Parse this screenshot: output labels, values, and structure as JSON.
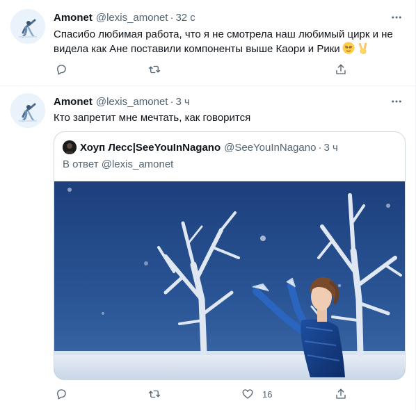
{
  "tweets": [
    {
      "author": "Amonet",
      "handle": "@lexis_amonet",
      "separator": "·",
      "time": "32 с",
      "text": "Спасибо любимая работа, что я не смотрела наш любимый цирк и не видела как Ане поставили компоненты выше Каори и Рики",
      "emojis": [
        "relieved-face-emoji",
        "victory-hand-emoji"
      ],
      "actions": {
        "reply": "",
        "retweet": "",
        "share": ""
      }
    },
    {
      "author": "Amonet",
      "handle": "@lexis_amonet",
      "separator": "·",
      "time": "3 ч",
      "text": "Кто запретит мне мечтать, как говорится",
      "quote": {
        "author": "Хоуп Лесс|SeeYouInNagano",
        "handle": "@SeeYouInNagano",
        "separator": "·",
        "time": "3 ч",
        "reply_to": "В ответ @lexis_amonet",
        "media": "figure-skater-photo"
      },
      "actions": {
        "reply": "",
        "retweet": "",
        "like_count": "16",
        "share": ""
      }
    }
  ],
  "icons": {
    "more": "more-icon",
    "reply": "reply-icon",
    "retweet": "retweet-icon",
    "like": "like-icon",
    "share": "share-icon"
  },
  "colors": {
    "text_primary": "#0f1419",
    "text_secondary": "#536471",
    "border": "#cfd9de",
    "divider": "#eff3f4"
  }
}
